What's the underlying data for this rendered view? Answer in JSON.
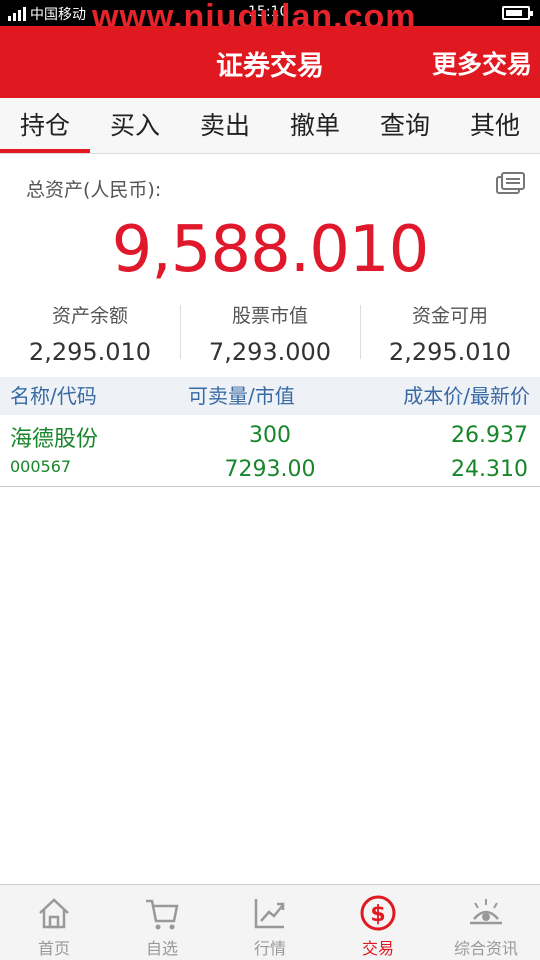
{
  "status_bar": {
    "carrier": "中国移动",
    "time": "15:10"
  },
  "watermark": "www.niugulan.com",
  "header": {
    "title": "证券交易",
    "more": "更多交易"
  },
  "tabs": [
    "持仓",
    "买入",
    "卖出",
    "撤单",
    "查询",
    "其他"
  ],
  "assets": {
    "label": "总资产(人民币):",
    "total": "9,588.010",
    "summary": [
      {
        "label": "资产余额",
        "value": "2,295.010"
      },
      {
        "label": "股票市值",
        "value": "7,293.000"
      },
      {
        "label": "资金可用",
        "value": "2,295.010"
      }
    ]
  },
  "table": {
    "headers": [
      "名称/代码",
      "可卖量/市值",
      "成本价/最新价"
    ],
    "rows": [
      {
        "name": "海德股份",
        "code": "000567",
        "qty": "300",
        "market_value": "7293.00",
        "cost": "26.937",
        "last": "24.310"
      }
    ]
  },
  "nav": [
    {
      "label": "首页",
      "icon": "home-icon"
    },
    {
      "label": "自选",
      "icon": "cart-icon"
    },
    {
      "label": "行情",
      "icon": "chart-icon"
    },
    {
      "label": "交易",
      "icon": "dollar-icon"
    },
    {
      "label": "综合资讯",
      "icon": "news-icon"
    }
  ],
  "colors": {
    "brand_red": "#e0181f",
    "gain_green": "#17862a",
    "link_blue": "#3a6aa4"
  }
}
